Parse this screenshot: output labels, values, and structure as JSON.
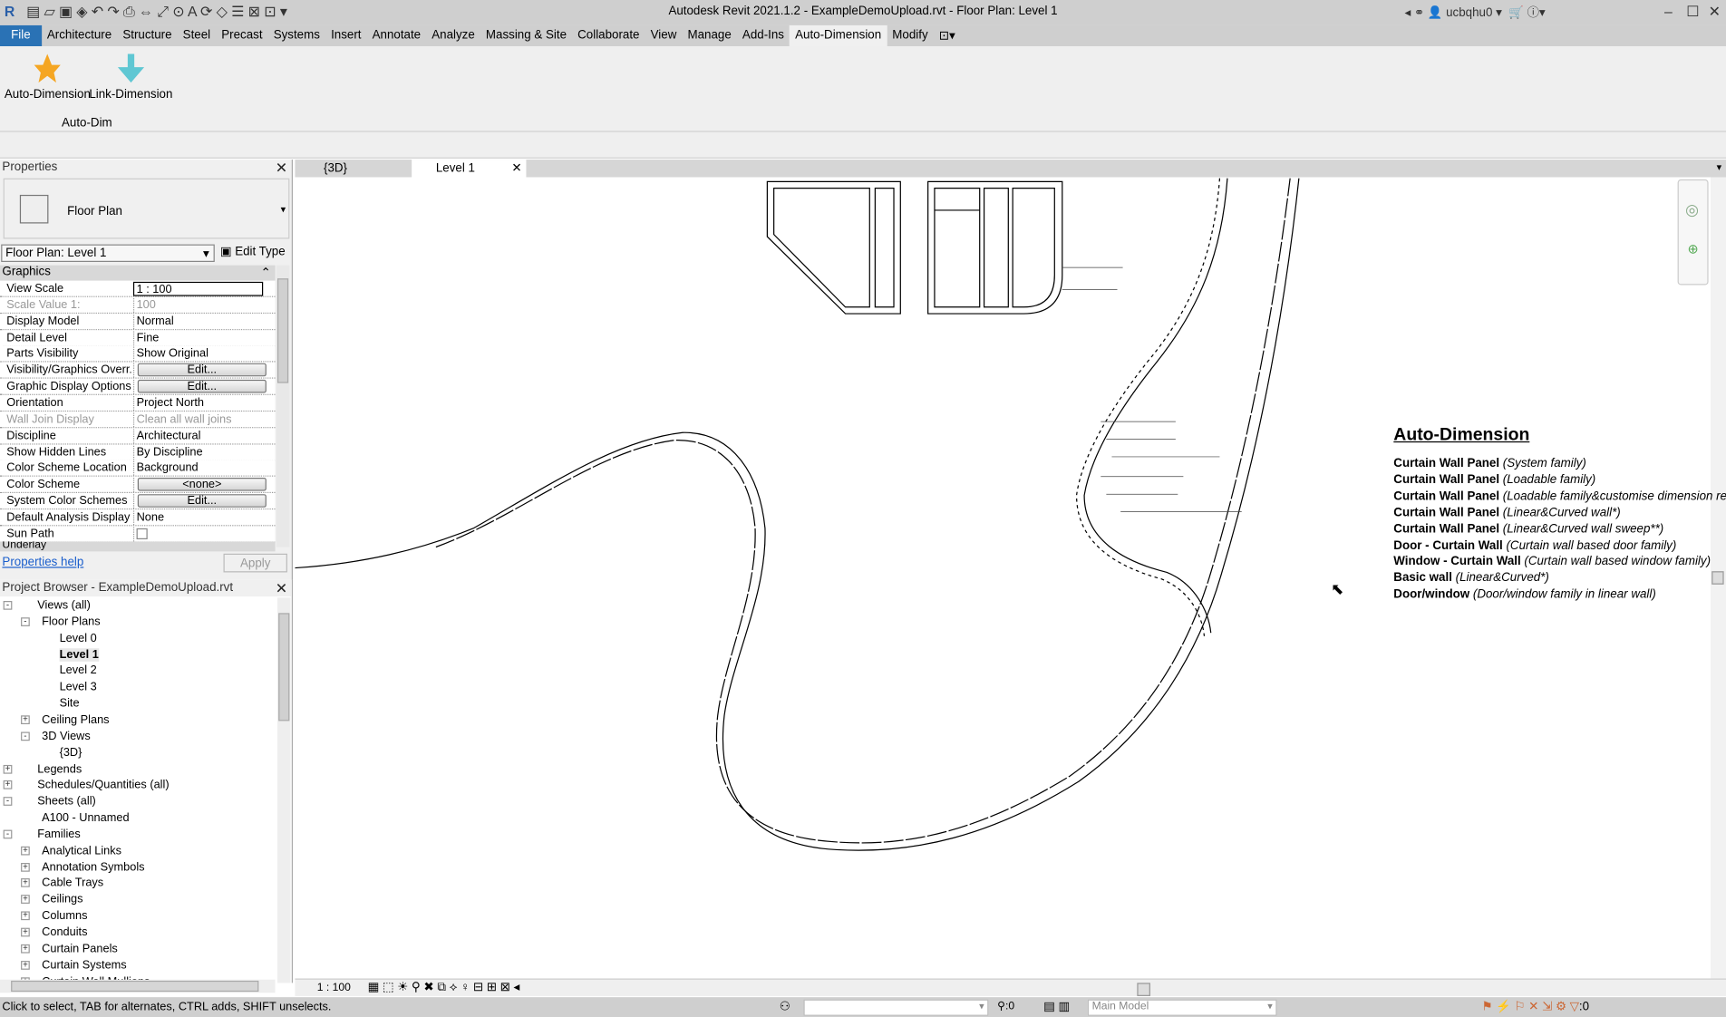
{
  "window": {
    "title": "Autodesk Revit 2021.1.2 - ExampleDemoUpload.rvt - Floor Plan: Level 1",
    "user": "ucbqhu0"
  },
  "ribbon": {
    "tabs": [
      "File",
      "Architecture",
      "Structure",
      "Steel",
      "Precast",
      "Systems",
      "Insert",
      "Annotate",
      "Analyze",
      "Massing & Site",
      "Collaborate",
      "View",
      "Manage",
      "Add-Ins",
      "Auto-Dimension",
      "Modify"
    ],
    "active_tab": "Auto-Dimension",
    "buttons": [
      "Auto-Dimension",
      "Link-Dimension"
    ],
    "panel_label": "Auto-Dim"
  },
  "properties": {
    "title": "Properties",
    "type_name": "Floor Plan",
    "selector": "Floor Plan: Level 1",
    "edit_type": "Edit Type",
    "group": "Graphics",
    "group2": "Underlay",
    "rows": [
      {
        "k": "View Scale",
        "v": "1 : 100"
      },
      {
        "k": "Scale Value    1:",
        "v": "100"
      },
      {
        "k": "Display Model",
        "v": "Normal"
      },
      {
        "k": "Detail Level",
        "v": "Fine"
      },
      {
        "k": "Parts Visibility",
        "v": "Show Original"
      },
      {
        "k": "Visibility/Graphics Overr...",
        "v": "Edit..."
      },
      {
        "k": "Graphic Display Options",
        "v": "Edit..."
      },
      {
        "k": "Orientation",
        "v": "Project North"
      },
      {
        "k": "Wall Join Display",
        "v": "Clean all wall joins"
      },
      {
        "k": "Discipline",
        "v": "Architectural"
      },
      {
        "k": "Show Hidden Lines",
        "v": "By Discipline"
      },
      {
        "k": "Color Scheme Location",
        "v": "Background"
      },
      {
        "k": "Color Scheme",
        "v": "<none>"
      },
      {
        "k": "System Color Schemes",
        "v": "Edit..."
      },
      {
        "k": "Default Analysis Display ...",
        "v": "None"
      },
      {
        "k": "Sun Path",
        "v": ""
      }
    ],
    "help": "Properties help",
    "apply": "Apply"
  },
  "browser": {
    "title": "Project Browser - ExampleDemoUpload.rvt",
    "items": [
      {
        "t": "Views (all)",
        "l": 0,
        "e": "-"
      },
      {
        "t": "Floor Plans",
        "l": 1,
        "e": "-"
      },
      {
        "t": "Level 0",
        "l": 2
      },
      {
        "t": "Level 1",
        "l": 2,
        "bold": true
      },
      {
        "t": "Level 2",
        "l": 2
      },
      {
        "t": "Level 3",
        "l": 2
      },
      {
        "t": "Site",
        "l": 2
      },
      {
        "t": "Ceiling Plans",
        "l": 1,
        "e": "+"
      },
      {
        "t": "3D Views",
        "l": 1,
        "e": "-"
      },
      {
        "t": "{3D}",
        "l": 2
      },
      {
        "t": "Legends",
        "l": 0,
        "e": "+"
      },
      {
        "t": "Schedules/Quantities (all)",
        "l": 0,
        "e": "+"
      },
      {
        "t": "Sheets (all)",
        "l": 0,
        "e": "-"
      },
      {
        "t": "A100 - Unnamed",
        "l": 1
      },
      {
        "t": "Families",
        "l": 0,
        "e": "-"
      },
      {
        "t": "Analytical Links",
        "l": 1,
        "e": "+"
      },
      {
        "t": "Annotation Symbols",
        "l": 1,
        "e": "+"
      },
      {
        "t": "Cable Trays",
        "l": 1,
        "e": "+"
      },
      {
        "t": "Ceilings",
        "l": 1,
        "e": "+"
      },
      {
        "t": "Columns",
        "l": 1,
        "e": "+"
      },
      {
        "t": "Conduits",
        "l": 1,
        "e": "+"
      },
      {
        "t": "Curtain Panels",
        "l": 1,
        "e": "+"
      },
      {
        "t": "Curtain Systems",
        "l": 1,
        "e": "+"
      },
      {
        "t": "Curtain Wall Mullions",
        "l": 1,
        "e": "+"
      }
    ]
  },
  "view_tabs": [
    {
      "label": "{3D}"
    },
    {
      "label": "Level 1",
      "active": true
    }
  ],
  "notes": {
    "title": "Auto-Dimension",
    "lines": [
      {
        "b": "Curtain Wall Panel",
        "i": "(System family)"
      },
      {
        "b": "Curtain Wall Panel",
        "i": "(Loadable family)"
      },
      {
        "b": "Curtain Wall Panel",
        "i": "(Loadable family&customise dimension ref"
      },
      {
        "b": "Curtain Wall Panel",
        "i": "(Linear&Curved wall*)"
      },
      {
        "b": "Curtain Wall Panel",
        "i": "(Linear&Curved wall sweep**)"
      },
      {
        "b": "Door - Curtain Wall",
        "i": "(Curtain wall based door family)"
      },
      {
        "b": "Window - Curtain Wall",
        "i": "(Curtain wall based window family)"
      },
      {
        "b": "Basic wall",
        "i": "(Linear&Curved*)"
      },
      {
        "b": "Door/window",
        "i": "(Door/window family in linear wall)"
      }
    ]
  },
  "view_control": {
    "scale": "1 : 100"
  },
  "status": {
    "hint": "Click to select, TAB for alternates, CTRL adds, SHIFT unselects.",
    "model": "Main Model",
    "worksets": ":0",
    "filter": ":0"
  }
}
